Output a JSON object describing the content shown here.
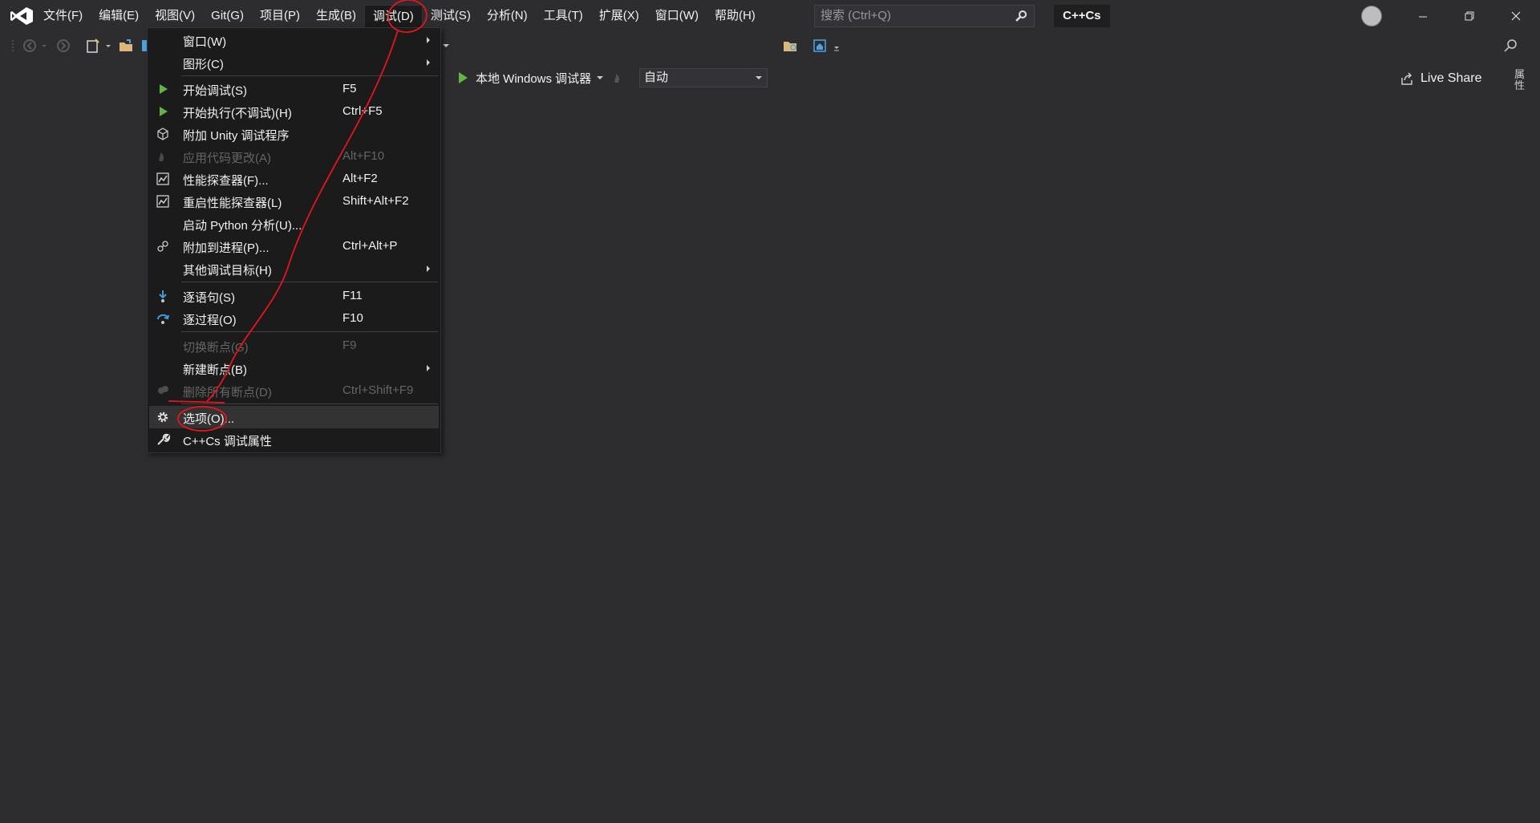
{
  "menubar": {
    "items": [
      "文件(F)",
      "编辑(E)",
      "视图(V)",
      "Git(G)",
      "项目(P)",
      "生成(B)",
      "调试(D)",
      "测试(S)",
      "分析(N)",
      "工具(T)",
      "扩展(X)",
      "窗口(W)",
      "帮助(H)"
    ],
    "active": "调试(D)"
  },
  "search": {
    "placeholder": "搜索 (Ctrl+Q)"
  },
  "solution_name": "C++Cs",
  "toolbar": {
    "debugger_label": "本地 Windows 调试器",
    "config_value": "自动",
    "live_share_label": "Live Share"
  },
  "side_panel": {
    "label": "属性"
  },
  "debug_menu": {
    "items": [
      {
        "label": "窗口(W)",
        "shortcut": "",
        "submenu": true,
        "icon": ""
      },
      {
        "label": "图形(C)",
        "shortcut": "",
        "submenu": true,
        "icon": ""
      },
      {
        "label": "开始调试(S)",
        "shortcut": "F5",
        "icon": "play-icon"
      },
      {
        "label": "开始执行(不调试)(H)",
        "shortcut": "Ctrl+F5",
        "icon": "play-outline-icon"
      },
      {
        "label": "附加 Unity 调试程序",
        "shortcut": "",
        "icon": "unity-cube-icon"
      },
      {
        "label": "应用代码更改(A)",
        "shortcut": "Alt+F10",
        "icon": "hot-reload-icon",
        "disabled": true
      },
      {
        "label": "性能探查器(F)...",
        "shortcut": "Alt+F2",
        "icon": "profiler-icon"
      },
      {
        "label": "重启性能探查器(L)",
        "shortcut": "Shift+Alt+F2",
        "icon": "profiler-icon"
      },
      {
        "label": "启动 Python 分析(U)...",
        "shortcut": "",
        "icon": ""
      },
      {
        "label": "附加到进程(P)...",
        "shortcut": "Ctrl+Alt+P",
        "icon": "attach-process-icon"
      },
      {
        "label": "其他调试目标(H)",
        "shortcut": "",
        "submenu": true,
        "icon": ""
      },
      {
        "label": "逐语句(S)",
        "shortcut": "F11",
        "icon": "step-into-icon"
      },
      {
        "label": "逐过程(O)",
        "shortcut": "F10",
        "icon": "step-over-icon"
      },
      {
        "label": "切换断点(G)",
        "shortcut": "F9",
        "icon": "",
        "disabled": true
      },
      {
        "label": "新建断点(B)",
        "shortcut": "",
        "submenu": true,
        "icon": ""
      },
      {
        "label": "删除所有断点(D)",
        "shortcut": "Ctrl+Shift+F9",
        "icon": "delete-breakpoints-icon",
        "disabled": true
      },
      {
        "label": "选项(O)...",
        "shortcut": "",
        "icon": "gear-icon",
        "highlighted": true
      },
      {
        "label": "C++Cs 调试属性",
        "shortcut": "",
        "icon": "wrench-icon"
      }
    ]
  },
  "colors": {
    "background": "#2d2d30",
    "menu_bg": "#1b1b1c",
    "play_green": "#62b543",
    "annotation_red": "#e8141c",
    "step_blue": "#3f9ddc"
  }
}
